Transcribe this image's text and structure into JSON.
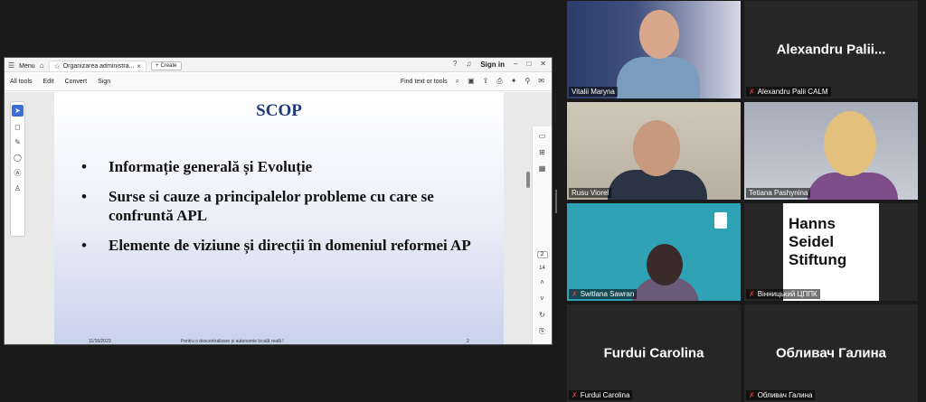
{
  "shared_window": {
    "menu_label": "Menu",
    "tab_title": "Organizarea administra...",
    "create_label": "Create",
    "sign_in": "Sign in",
    "toolbar": {
      "all_tools": "All tools",
      "edit": "Edit",
      "convert": "Convert",
      "sign": "Sign",
      "find": "Find text or tools"
    },
    "page_current": "2",
    "page_total": "14",
    "slide": {
      "title": "SCOP",
      "bullets": [
        "Informație generală și Evoluție",
        "Surse si cauze a principalelor probleme cu care se confruntă APL",
        "Elemente de viziune și direcții în domeniul reformei AP"
      ],
      "footer_date": "11/16/2023",
      "footer_text": "Pentru o descentralizare și autonomie locală reală !",
      "footer_page": "2"
    }
  },
  "participants": [
    {
      "name": "Vitalii Maryna",
      "video": true,
      "muted": false
    },
    {
      "name": "Alexandru Palii CALM",
      "big_name": "Alexandru  Palii...",
      "video": false,
      "muted": true
    },
    {
      "name": "Rusu Viorel",
      "video": true,
      "muted": false,
      "active": true
    },
    {
      "name": "Tetiana    Pashynina",
      "video": true,
      "muted": false
    },
    {
      "name": "Switlana Sawran",
      "video": true,
      "muted": true
    },
    {
      "name": "Вінницький ЦППК",
      "video": true,
      "muted": true,
      "logo_text": "Hanns Seidel Stiftung"
    },
    {
      "name": "Furdui Carolina",
      "big_name": "Furdui Carolina",
      "video": false,
      "muted": true
    },
    {
      "name": "Обливач Галина",
      "big_name": "Обливач Галина",
      "video": false,
      "muted": true
    }
  ],
  "colors": {
    "active_border": "#c9e24a",
    "muted_icon": "#e03b3b",
    "slide_title": "#1f3a7a"
  }
}
